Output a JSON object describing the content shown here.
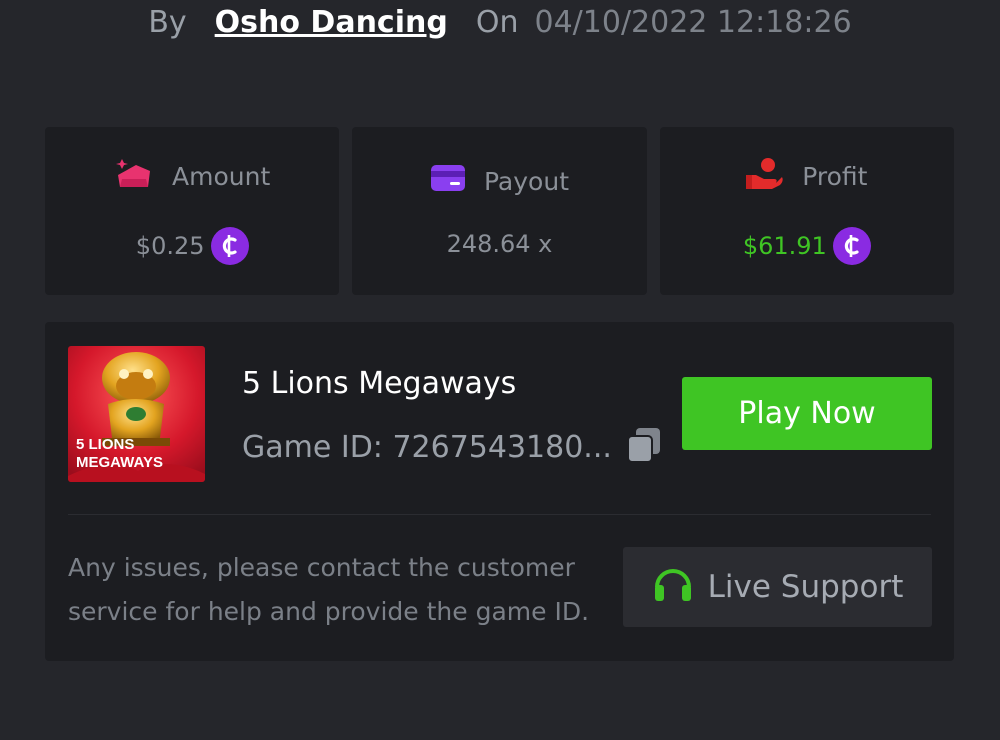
{
  "byline": {
    "by_label": "By",
    "username": "Osho Dancing",
    "on_label": "On",
    "datetime": "04/10/2022 12:18:26"
  },
  "stats": {
    "amount": {
      "label": "Amount",
      "value": "$0.25",
      "icon": "wallet-add-icon",
      "icon_color": "#e8336f"
    },
    "payout": {
      "label": "Payout",
      "value": "248.64 x",
      "icon": "credit-card-icon",
      "icon_color": "#8a3ff0"
    },
    "profit": {
      "label": "Profit",
      "value": "$61.91",
      "icon": "hand-money-icon",
      "icon_color": "#e32b2b",
      "value_color": "#3fc524"
    }
  },
  "coin_icon": {
    "name": "coin-icon",
    "color": "#8a2be2",
    "glyph": "₵"
  },
  "game": {
    "title": "5 Lions Megaways",
    "thumb_text_line1": "5 LIONS",
    "thumb_text_line2": "MEGAWAYS",
    "game_id": "Game ID: 7267543180...",
    "play_label": "Play Now"
  },
  "support": {
    "help_text": "Any issues, please contact the customer service for help and provide the game ID.",
    "button_label": "Live Support",
    "icon_color": "#3fc524"
  },
  "colors": {
    "background": "#25262b",
    "card": "#1c1d21",
    "accent_green": "#3fc524"
  }
}
